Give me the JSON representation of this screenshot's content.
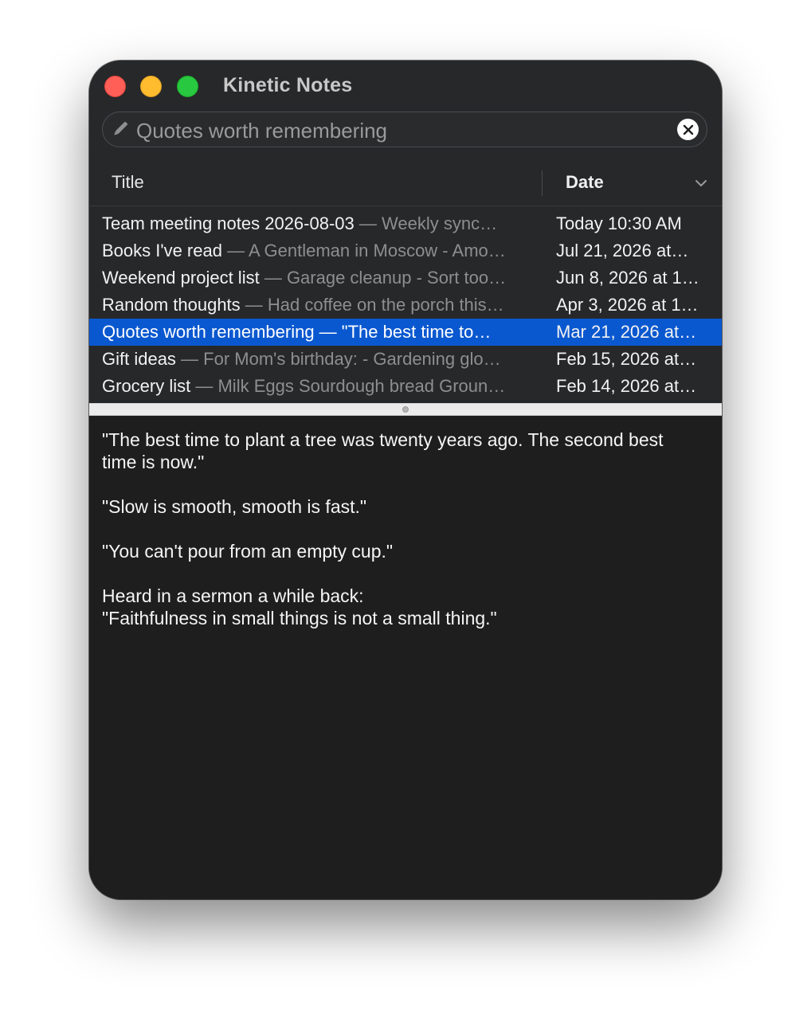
{
  "app": {
    "title": "Kinetic Notes"
  },
  "search": {
    "value": "Quotes worth remembering",
    "icon": "pencil-icon",
    "clear_icon": "close-icon"
  },
  "table": {
    "columns": [
      "Title",
      "Date"
    ],
    "sort_indicator_icon": "chevron-down-icon",
    "rows": [
      {
        "title": "Team meeting notes 2026-08-03",
        "sep": " — ",
        "snippet": "Weekly sync…",
        "date": "Today  10:30 AM",
        "selected": false
      },
      {
        "title": "Books I've read",
        "sep": " — ",
        "snippet": "A Gentleman in Moscow - Amo…",
        "date": "Jul 21, 2026 at…",
        "selected": false
      },
      {
        "title": "Weekend project list",
        "sep": " — ",
        "snippet": "Garage cleanup - Sort too…",
        "date": "Jun 8, 2026 at 1…",
        "selected": false
      },
      {
        "title": "Random thoughts",
        "sep": " — ",
        "snippet": "Had coffee on the porch this…",
        "date": "Apr 3, 2026 at 1…",
        "selected": false
      },
      {
        "title": "Quotes worth remembering",
        "sep": " — ",
        "snippet": "\"The best time to…",
        "date": "Mar 21, 2026 at…",
        "selected": true
      },
      {
        "title": "Gift ideas",
        "sep": " — ",
        "snippet": "For Mom's birthday: - Gardening glo…",
        "date": "Feb 15, 2026 at…",
        "selected": false
      },
      {
        "title": "Grocery list",
        "sep": " — ",
        "snippet": "Milk Eggs Sourdough bread Groun…",
        "date": "Feb 14, 2026 at…",
        "selected": false
      }
    ]
  },
  "editor": {
    "content": "\"The best time to plant a tree was twenty years ago. The second best time is now.\"\n\n\"Slow is smooth, smooth is fast.\"\n\n\"You can't pour from an empty cup.\"\n\nHeard in a sermon a while back:\n\"Faithfulness in small things is not a small thing.\""
  },
  "colors": {
    "selection": "#0a58d0",
    "window_bg": "#1e1e1e",
    "chrome_bg": "#27282a",
    "close": "#ff5f57",
    "minimize": "#febc2e",
    "zoom": "#28c840"
  }
}
